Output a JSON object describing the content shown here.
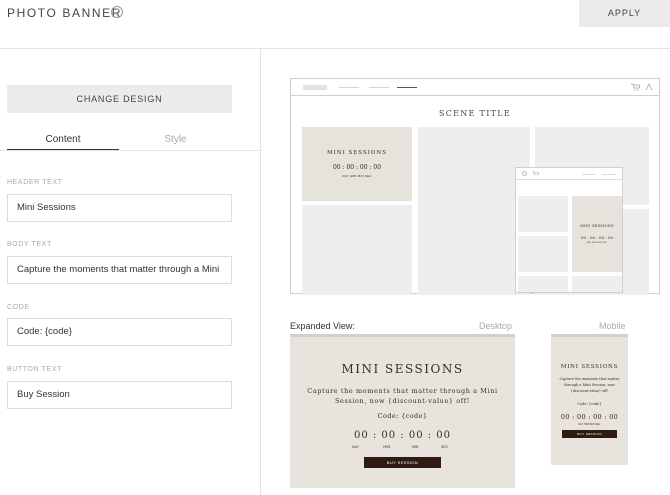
{
  "header": {
    "title": "PHOTO BANNER",
    "help_icon": "help-icon",
    "apply_label": "APPLY"
  },
  "editor": {
    "change_design_label": "CHANGE DESIGN",
    "tabs": [
      {
        "label": "Content",
        "active": true
      },
      {
        "label": "Style",
        "active": false
      }
    ],
    "fields": {
      "header_text": {
        "label": "HEADER TEXT",
        "value": "Mini Sessions"
      },
      "body_text": {
        "label": "BODY TEXT",
        "value": "Capture the moments that matter through a Mini"
      },
      "code": {
        "label": "CODE",
        "value": "Code: {code}"
      },
      "button_text": {
        "label": "BUTTON TEXT",
        "value": "Buy Session"
      }
    }
  },
  "preview": {
    "scene_title": "SCENE TITLE",
    "mini": {
      "heading": "MINI SESSIONS",
      "heading_small": "MINI SESSIONS",
      "countdown": "00 : 00 : 00 : 00",
      "units": "DAY  HRS  MIN  SEC"
    },
    "icons": [
      "cart-icon",
      "user-icon"
    ]
  },
  "expanded": {
    "label": "Expanded View:",
    "desktop_label": "Desktop",
    "mobile_label": "Mobile",
    "desktop": {
      "heading": "MINI SESSIONS",
      "body_line1": "Capture the moments that matter through a Mini",
      "body_line2": "Session, now {discount-value} off!",
      "code": "Code: {code}",
      "countdown": "00 : 00 : 00 : 00",
      "units": [
        "DAY",
        "HRS",
        "MIN",
        "SEC"
      ],
      "button": "BUY SESSION"
    },
    "mobile": {
      "heading": "MINI SESSIONS",
      "body_line1": "Capture the moments that matter",
      "body_line2": "through a Mini Session, now",
      "body_line3": "{discount-value} off!",
      "code": "Code: {code}",
      "countdown": "00 : 00 : 00 : 00",
      "units": "DAY  HRS  MIN  SEC",
      "button": "BUY SESSION"
    }
  },
  "colors": {
    "banner_bg": "#e8e4dd",
    "dark_brown": "#2f1b12",
    "panel_gray": "#ebebeb"
  }
}
